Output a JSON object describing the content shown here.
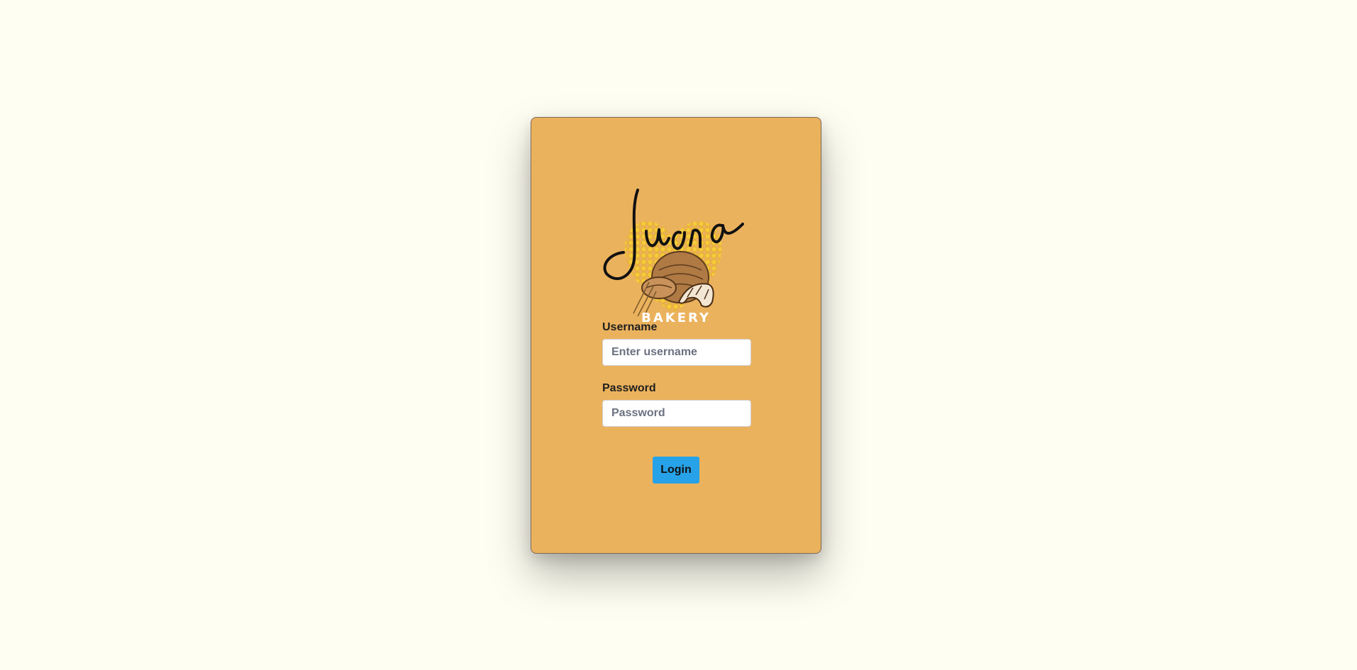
{
  "logo": {
    "script_text": "Juana",
    "subtitle": "BAKERY"
  },
  "form": {
    "username_label": "Username",
    "username_placeholder": "Enter username",
    "username_value": "",
    "password_label": "Password",
    "password_placeholder": "Password",
    "password_value": "",
    "login_label": "Login"
  },
  "colors": {
    "page_background": "#fffef2",
    "card_background": "#ebb25d",
    "button": "#27a2e8"
  }
}
